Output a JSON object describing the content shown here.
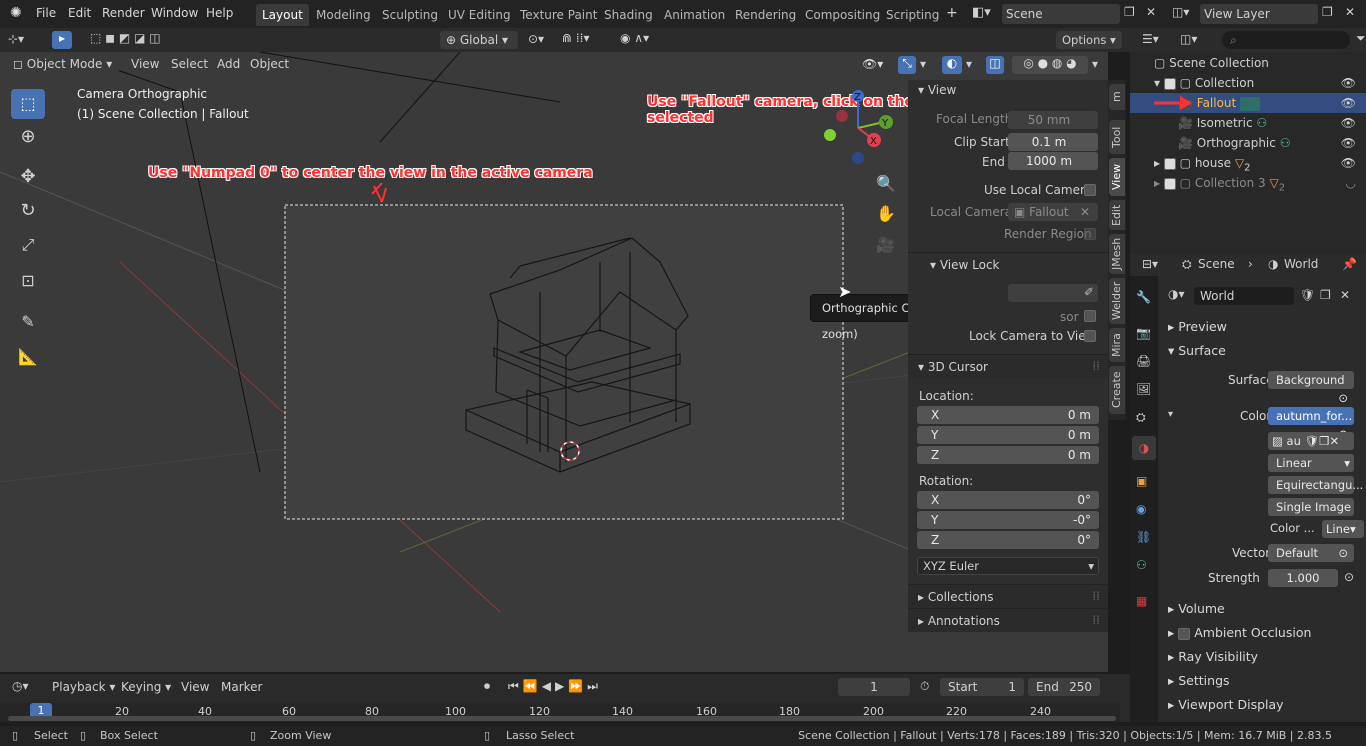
{
  "topbar": {
    "menus": [
      "File",
      "Edit",
      "Render",
      "Window",
      "Help"
    ],
    "workspaces": [
      "Layout",
      "Modeling",
      "Sculpting",
      "UV Editing",
      "Texture Paint",
      "Shading",
      "Animation",
      "Rendering",
      "Compositing",
      "Scripting"
    ],
    "add_label": "+",
    "scene": "Scene",
    "view_layer": "View Layer"
  },
  "viewport_header": {
    "orientation": "Global",
    "options": "Options",
    "mode": "Object Mode",
    "menus": [
      "View",
      "Select",
      "Add",
      "Object"
    ]
  },
  "viewport": {
    "camera_title": "Camera Orthographic",
    "collection_info": "(1) Scene Collection | Fallout",
    "annot_numpad": "Use \"Numpad 0\" to center the view in the active camera",
    "annot_fallout": "Use \"Fallout\" camera, click on the green item if it's not selected",
    "tooltip": "Orthographic Camera scale (similar to zoom)",
    "gizmo_y": "Y",
    "gizmo_x": "X",
    "gizmo_z": "Z"
  },
  "npanel": {
    "view_header": "View",
    "focal_length_label": "Focal Length",
    "focal_length": "50 mm",
    "clip_start_label": "Clip Start",
    "clip_start": "0.1 m",
    "end_label": "End",
    "end": "1000 m",
    "use_local_camera": "Use Local Camera",
    "local_camera_label": "Local Camera",
    "local_camera": "Fallout",
    "render_region": "Render Region",
    "view_lock_header": "View Lock",
    "sor_fragment": "sor",
    "lock_camera": "Lock Camera to View",
    "cursor_header": "3D Cursor",
    "location_label": "Location:",
    "loc": [
      {
        "axis": "X",
        "val": "0 m"
      },
      {
        "axis": "Y",
        "val": "0 m"
      },
      {
        "axis": "Z",
        "val": "0 m"
      }
    ],
    "rotation_label": "Rotation:",
    "rot": [
      {
        "axis": "X",
        "val": "0°"
      },
      {
        "axis": "Y",
        "val": "-0°"
      },
      {
        "axis": "Z",
        "val": "0°"
      }
    ],
    "rot_mode": "XYZ Euler",
    "collections": "Collections",
    "annotations": "Annotations",
    "tabs": [
      "Create",
      "Mira",
      "Welder",
      "JMesh",
      "Edit",
      "View",
      "Tool",
      "m"
    ]
  },
  "outliner": {
    "root": "Scene Collection",
    "rows": [
      {
        "name": "Collection",
        "indent": 1
      },
      {
        "name": "Fallout",
        "indent": 2
      },
      {
        "name": "Isometric",
        "indent": 2
      },
      {
        "name": "Orthographic",
        "indent": 2
      },
      {
        "name": "house",
        "indent": 1
      },
      {
        "name": "Collection 3",
        "indent": 1
      }
    ],
    "badge_house": "2",
    "badge_col3": "2"
  },
  "props": {
    "scene_tab": "Scene",
    "world_tab": "World",
    "world_name": "World",
    "preview": "Preview",
    "surface": "Surface",
    "surface_label": "Surface",
    "surface_val": "Background",
    "color_label": "Color",
    "color_val": "autumn_for...",
    "img_name": "au",
    "interp": "Linear",
    "projection": "Equirectangu...",
    "source": "Single Image",
    "colorspace_label": "Color ...",
    "colorspace_val": "Line",
    "vector_label": "Vector",
    "vector_val": "Default",
    "strength_label": "Strength",
    "strength_val": "1.000",
    "volume": "Volume",
    "ao": "Ambient Occlusion",
    "ray": "Ray Visibility",
    "settings": "Settings",
    "vpdisplay": "Viewport Display"
  },
  "timeline": {
    "menus": [
      "Playback",
      "Keying",
      "View",
      "Marker"
    ],
    "current": "1",
    "start_label": "Start",
    "start": "1",
    "end_label": "End",
    "end": "250",
    "ticks": [
      "20",
      "40",
      "60",
      "80",
      "100",
      "120",
      "140",
      "160",
      "180",
      "200",
      "220",
      "240"
    ],
    "frame_marker": "1"
  },
  "status": {
    "select": "Select",
    "box_select": "Box Select",
    "zoom_view": "Zoom View",
    "lasso": "Lasso Select",
    "info": "Scene Collection | Fallout | Verts:178 | Faces:189 | Tris:320 | Objects:1/5 | Mem: 16.7 MiB | 2.83.5"
  }
}
